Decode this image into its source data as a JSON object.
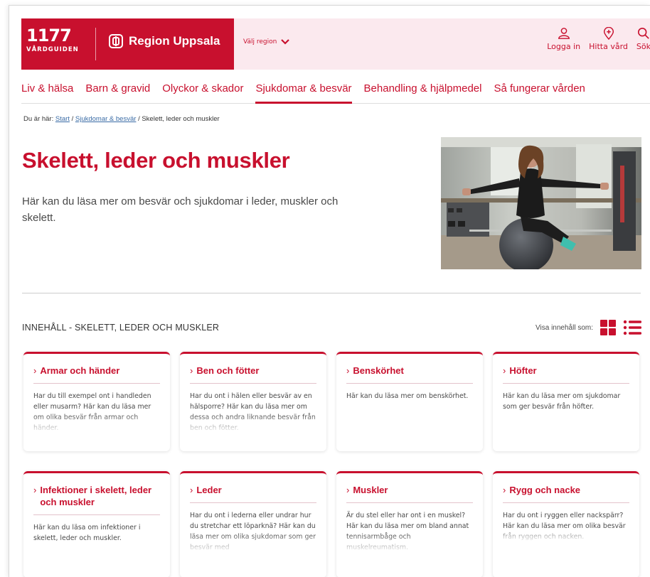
{
  "brand": {
    "logo_number": "1177",
    "logo_subtitle": "VÅRDGUIDEN",
    "region_name": "Region Uppsala",
    "region_select_label": "Välj region",
    "primary_color": "#c8102e"
  },
  "header_actions": [
    {
      "label": "Logga in",
      "icon": "person-icon"
    },
    {
      "label": "Hitta vård",
      "icon": "location-pin-icon"
    },
    {
      "label": "Sök",
      "icon": "search-icon"
    }
  ],
  "nav": {
    "items": [
      {
        "label": "Liv & hälsa"
      },
      {
        "label": "Barn & gravid"
      },
      {
        "label": "Olyckor & skador"
      },
      {
        "label": "Sjukdomar & besvär"
      },
      {
        "label": "Behandling & hjälpmedel"
      },
      {
        "label": "Så fungerar vården"
      }
    ],
    "active_label": "Sjukdomar & besvär"
  },
  "breadcrumb": {
    "prefix": "Du är här:",
    "links": [
      "Start",
      "Sjukdomar & besvär"
    ],
    "separator": "/",
    "current": "Skelett, leder och muskler"
  },
  "page": {
    "title": "Skelett, leder och muskler",
    "intro": "Här kan du läsa mer om besvär och sjukdomar i leder, muskler och skelett."
  },
  "content": {
    "title": "INNEHÅLL - SKELETT, LEDER OCH MUSKLER",
    "view_label": "Visa innehåll som:",
    "view_mode": "grid"
  },
  "cards": [
    {
      "title": "Armar och händer",
      "text": "Har du till exempel ont i handleden eller musarm? Här kan du läsa mer om olika besvär från armar och händer."
    },
    {
      "title": "Ben och fötter",
      "text": "Har du ont i hälen eller besvär av en hälsporre? Här kan du läsa mer om dessa och andra liknande besvär från ben och fötter."
    },
    {
      "title": "Benskörhet",
      "text": "Här kan du läsa mer om benskörhet."
    },
    {
      "title": "Höfter",
      "text": "Här kan du läsa mer om sjukdomar som ger besvär från höfter."
    },
    {
      "title": "Infektioner i skelett, leder och muskler",
      "text": "Här kan du läsa om infektioner i skelett, leder och muskler."
    },
    {
      "title": "Leder",
      "text": "Har du ont i lederna eller undrar hur du stretchar ett löparknä? Här kan du läsa mer om olika sjukdomar som ger besvär med"
    },
    {
      "title": "Muskler",
      "text": "Är du stel eller har ont i en muskel? Här kan du läsa mer om bland annat tennisarmbåge och muskelreumatism."
    },
    {
      "title": "Rygg och nacke",
      "text": "Har du ont i ryggen eller nackspärr? Här kan du läsa mer om olika besvär från ryggen och nacken."
    }
  ]
}
